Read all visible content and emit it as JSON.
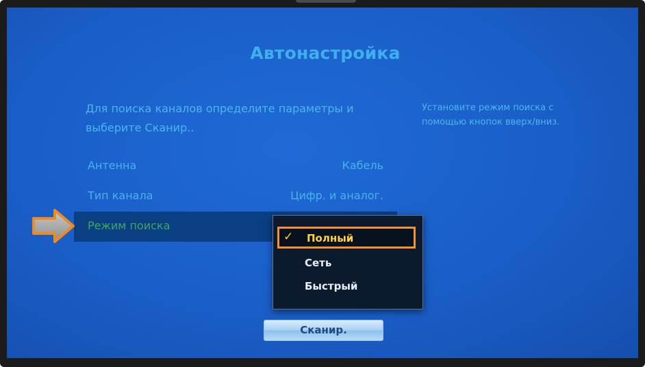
{
  "screen": {
    "title": "Автонастройка",
    "intro": "Для поиска каналов определите параметры и выберите Сканир..",
    "hint": "Установите режим поиска с помощью кнопок вверх/вниз."
  },
  "settings": [
    {
      "label": "Антенна",
      "value": "Кабель"
    },
    {
      "label": "Тип канала",
      "value": "Цифр. и аналог."
    },
    {
      "label": "Режим поиска",
      "value": ""
    }
  ],
  "dropdown": {
    "options": [
      "Полный",
      "Сеть",
      "Быстрый"
    ],
    "selected": "Полный",
    "check_mark": "✓"
  },
  "scan_button": {
    "label": "Сканир."
  },
  "colors": {
    "screen_bg": "#1a5ec8",
    "text": "#48b2ea",
    "focus_outline": "#f3922e",
    "selected_text": "#ffd23a"
  },
  "icons": {
    "pointer": "arrow-right-icon",
    "check": "check-icon"
  }
}
